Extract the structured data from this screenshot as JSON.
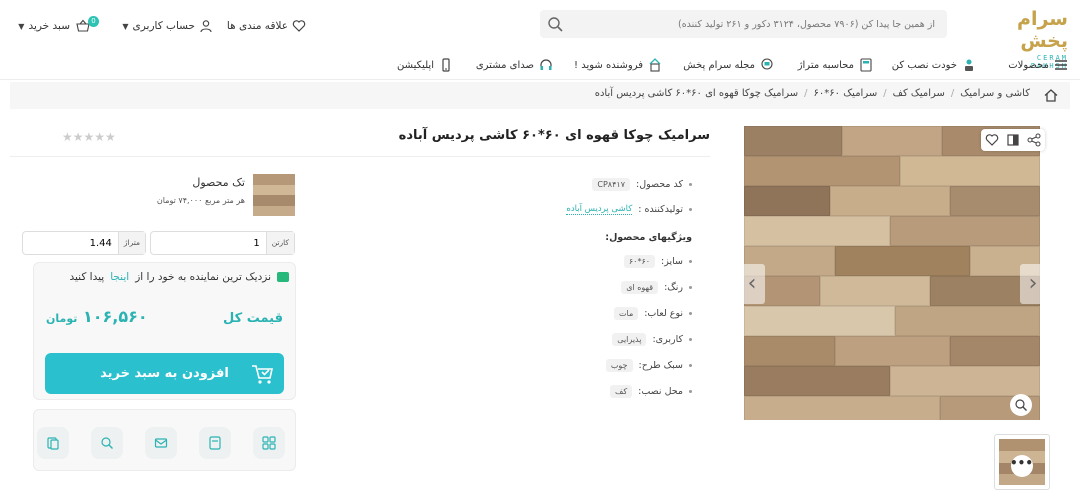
{
  "header": {
    "logo_text": "سرام پخش",
    "logo_sub": "CERAM PAKHSH",
    "search_placeholder": "از همین جا پیدا کن (۷۹۰۶ محصول، ۳۱۲۴ دکور و ۲۶۱ تولید کننده)",
    "favorites": "علاقه مندی ها",
    "account": "حساب کاربری",
    "cart": "سبد خرید",
    "cart_count": "0"
  },
  "nav": {
    "items": [
      "محصولات",
      "خودت نصب کن",
      "محاسبه متراژ",
      "مجله سرام پخش",
      "فروشنده شوید !",
      "صدای مشتری",
      "اپلیکیشن"
    ]
  },
  "breadcrumb": [
    "کاشی و سرامیک",
    "سرامیک کف",
    "سرامیک ۶۰*۶۰",
    "سرامیک چوکا قهوه ای ۶۰*۶۰ کاشی پردیس آباده"
  ],
  "product": {
    "title": "سرامیک چوکا قهوه ای ۶۰*۶۰ کاشی پردیس آباده",
    "stars": "★★★★★",
    "code_label": "کد محصول:",
    "code": "CP۸۴۱۷",
    "maker_label": "تولیدکننده :",
    "maker": "کاشی پردیس آباده",
    "specs_title": "ویژگیهای محصول:",
    "specs": [
      {
        "label": "سایز:",
        "value": "۶۰*۶۰"
      },
      {
        "label": "رنگ:",
        "value": "قهوه ای"
      },
      {
        "label": "نوع لعاب:",
        "value": "مات"
      },
      {
        "label": "کاربری:",
        "value": "پذیرایی"
      },
      {
        "label": "سبک طرح:",
        "value": "چوب"
      },
      {
        "label": "محل نصب:",
        "value": "کف"
      }
    ]
  },
  "buy": {
    "single_title": "تک محصول",
    "single_price": "هر متر مربع ۷۴,۰۰۰ تومان",
    "qty_unit": "کارتن",
    "qty_value": "1",
    "area_unit": "متراژ",
    "area_value": "1.44",
    "near_pre": "نزدیک ترین نماینده به خود را از",
    "near_link": "اینجا",
    "near_post": "پیدا کنید",
    "total_label": "قیمت کل",
    "total_value": "۱۰۶,۵۶۰",
    "currency": "تومان",
    "add_button": "افزودن به سبد خرید"
  },
  "colors": {
    "accent": "#2ac0cd",
    "teal": "#2bb3b3",
    "gold": "#c6a24a",
    "wood": "#b89472"
  }
}
